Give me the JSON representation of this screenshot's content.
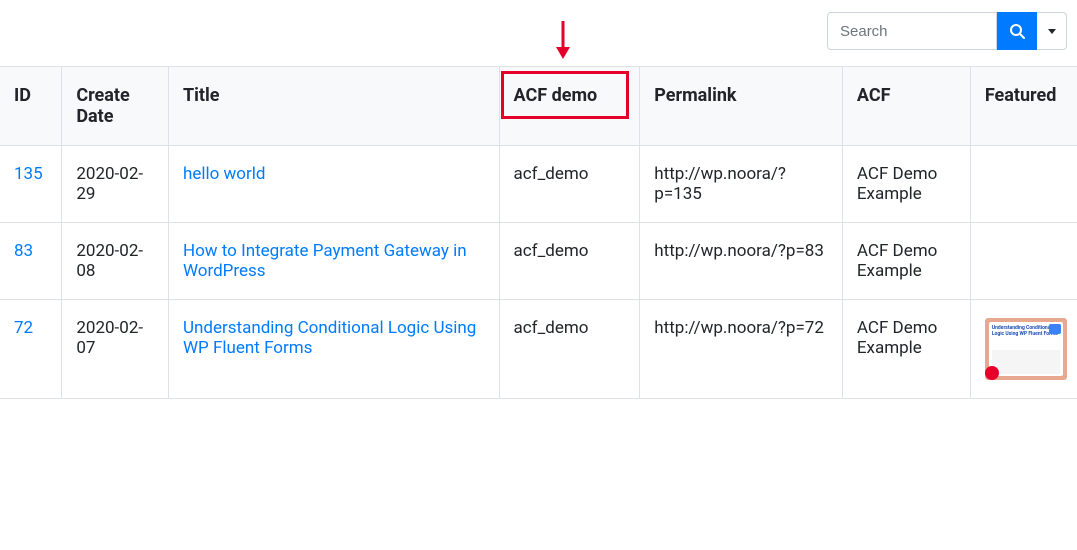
{
  "search": {
    "placeholder": "Search",
    "value": ""
  },
  "columns": {
    "id": "ID",
    "create_date": "Create Date",
    "title": "Title",
    "acf_demo": "ACF demo",
    "permalink": "Permalink",
    "acf": "ACF",
    "featured": "Featured"
  },
  "rows": [
    {
      "id": "135",
      "create_date": "2020-02-29",
      "title": "hello world",
      "acf_demo": "acf_demo",
      "permalink": "http://wp.noora/?p=135",
      "acf": "ACF Demo Example",
      "featured": null
    },
    {
      "id": "83",
      "create_date": "2020-02-08",
      "title": "How to Integrate Payment Gateway in WordPress",
      "acf_demo": "acf_demo",
      "permalink": "http://wp.noora/?p=83",
      "acf": "ACF Demo Example",
      "featured": null
    },
    {
      "id": "72",
      "create_date": "2020-02-07",
      "title": "Understanding Conditional Logic Using WP Fluent Forms",
      "acf_demo": "acf_demo",
      "permalink": "http://wp.noora/?p=72",
      "acf": "ACF Demo Example",
      "featured": {
        "text": "Understanding Conditional Logic Using WP Fluent Forms"
      }
    }
  ],
  "annotation": {
    "highlight_column": "acf_demo",
    "highlight_color": "#e4002b"
  }
}
